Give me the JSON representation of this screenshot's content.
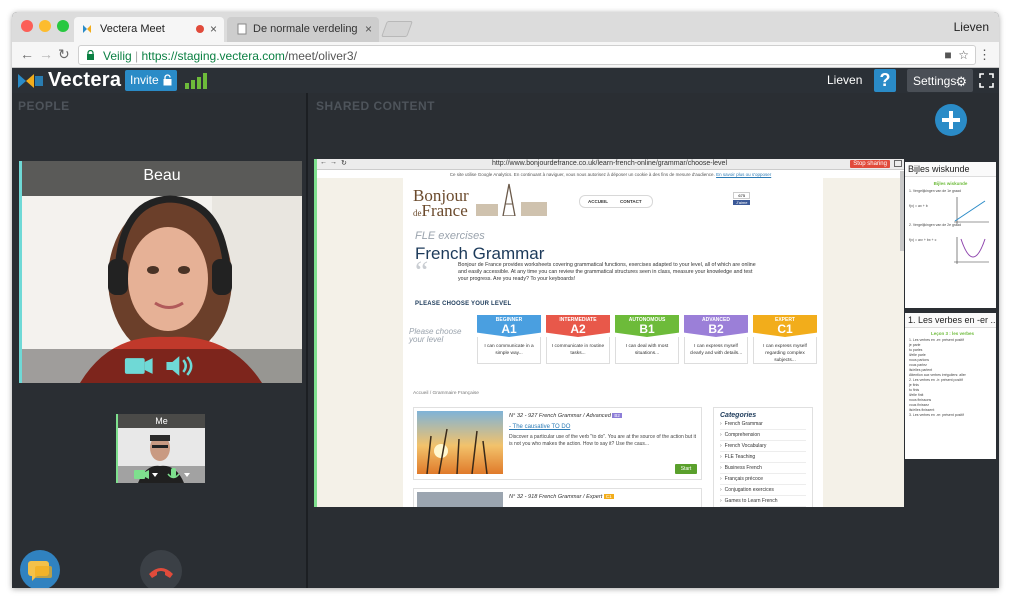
{
  "browser": {
    "tabs": [
      {
        "label": "Vectera Meet",
        "active": true
      },
      {
        "label": "De normale verdeling | Wiskun",
        "active": false
      }
    ],
    "profile_name": "Lieven",
    "secure_label": "Veilig",
    "url_host": "https://staging.vectera.com",
    "url_path": "/meet/oliver3/"
  },
  "app": {
    "brand": "Vectera",
    "invite_label": "Invite",
    "user_name": "Lieven",
    "help_label": "?",
    "settings_label": "Settings",
    "accent_color": "#2a8bc7"
  },
  "people": {
    "section_title": "PEOPLE",
    "participant_name": "Beau",
    "self_name": "Me"
  },
  "shared": {
    "section_title": "SHARED CONTENT",
    "frame_url": "http://www.bonjourdefrance.co.uk/learn-french-online/grammar/choose-level",
    "stop_sharing_label": "Stop sharing",
    "cookie_text": "Ce site utilise Google Analytics. En continuant à naviguer, vous nous autorisez à déposer un cookie à des fins de mesure d'audience.",
    "cookie_link": "En savoir plus ou s'opposer",
    "site": {
      "logo_line1": "Bonjour",
      "logo_de": "de",
      "logo_line2": "France",
      "nav_home": "ACCUEIL",
      "nav_contact": "CONTACT",
      "like_count": "675",
      "like_label": "J'aime",
      "subtitle": "FLE exercises",
      "heading": "French Grammar",
      "intro": "Bonjour de France provides worksheets covering grammatical functions, exercises adapted to your level, all of which are online and easily accessible. At any time you can review the grammatical structures seen in class, measure your knowledge and test your progress. Are you ready? To your keyboards!",
      "choose_level": "PLEASE CHOOSE YOUR LEVEL",
      "choose_side": "Please choose your level",
      "levels": [
        {
          "name": "BEGINNER",
          "code": "A1",
          "desc": "I can communicate in a simple way...",
          "color": "#4a9fe0"
        },
        {
          "name": "INTERMEDIATE",
          "code": "A2",
          "desc": "I communicate in routine tasks...",
          "color": "#e8584a"
        },
        {
          "name": "AUTONOMOUS",
          "code": "B1",
          "desc": "I can deal with most situations...",
          "color": "#6dbb3a"
        },
        {
          "name": "ADVANCED",
          "code": "B2",
          "desc": "I can express myself clearly and with details...",
          "color": "#9b7fd8"
        },
        {
          "name": "EXPERT",
          "code": "C1",
          "desc": "I can express myself regarding complex subjects...",
          "color": "#f2ad1b"
        }
      ],
      "breadcrumb_home": "Accueil",
      "breadcrumb_sep": "/",
      "breadcrumb_current": "Grammaire Française",
      "card1": {
        "meta": "N° 32 - 927 French Grammar / Advanced",
        "badge": "B2",
        "title": "- The causative TO DO",
        "desc": "Discover a particular use of the verb \"to do\". You are at the source of the action but it is not you who makes the action. How to say it? Use the caus...",
        "start": "Start"
      },
      "card2": {
        "meta": "N° 32 - 918 French Grammar / Expert",
        "badge": "C1"
      },
      "categories_title": "Categories",
      "categories": [
        "French Grammar",
        "Comprehension",
        "French Vocabulary",
        "FLE Teaching",
        "Business French",
        "Français précoce",
        "Conjugation exercices",
        "Games to Learn French"
      ]
    }
  },
  "slides": [
    {
      "title": "Bijles wiskunde",
      "heading": "Bijles wiskunde",
      "lines": [
        "1. Vergelijkingen van de 1e graad",
        "2. Vergelijkingen van de 2e graad"
      ],
      "formulas": [
        "f(x) = ax + b",
        "f(x) = ax² + bx + c"
      ]
    },
    {
      "title": "1. Les verbes en -er ...",
      "heading": "Leçon 3 : les verbes",
      "lines": [
        "1. Les verbes en -er: présent positif",
        "je parle",
        "tu parles",
        "il/elle parle",
        "nous parlons",
        "vous parlez",
        "ils/elles parlent",
        "Attention aux verbes irréguliers: aller",
        "2. Les verbes en -ir: présent positif",
        "je finis",
        "tu finis",
        "il/elle finit",
        "nous finissons",
        "vous finissez",
        "ils/elles finissent",
        "3. Les verbes en -re: présent positif"
      ]
    }
  ]
}
